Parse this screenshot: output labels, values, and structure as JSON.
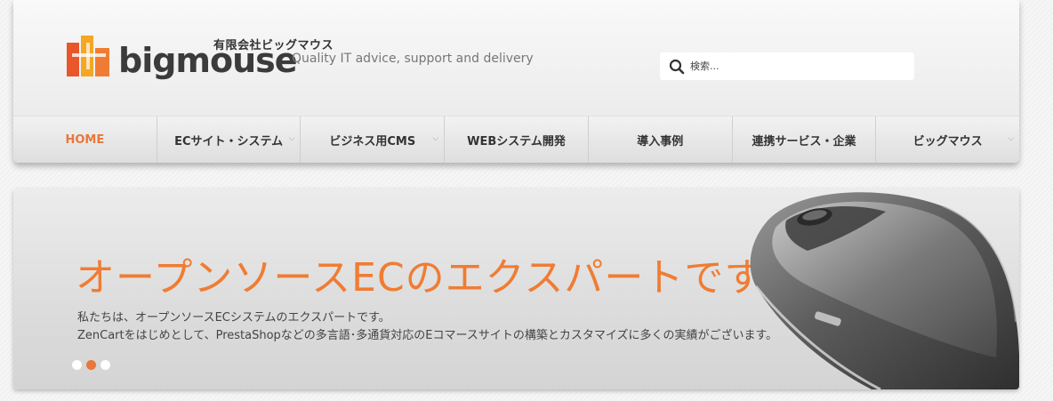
{
  "header": {
    "logo_kana": "有限会社ビッグマウス",
    "logo_name": "bigmouse",
    "tagline": "Quality IT advice, support and delivery",
    "search": {
      "placeholder": "検索..."
    }
  },
  "nav": {
    "items": [
      {
        "label": "HOME",
        "active": true
      },
      {
        "label": "ECサイト・システム",
        "dropdown": true
      },
      {
        "label": "ビジネス用CMS",
        "dropdown": true
      },
      {
        "label": "WEBシステム開発"
      },
      {
        "label": "導入事例"
      },
      {
        "label": "連携サービス・企業"
      },
      {
        "label": "ビッグマウス",
        "dropdown": true
      }
    ]
  },
  "hero": {
    "title": "オープンソースECのエクスパートです",
    "line1": "私たちは、オープンソースECシステムのエクスパートです。",
    "line2": "ZenCartをはじめとして、PrestaShopなどの多言語･多通貨対応のEコマースサイトの構築とカスタマイズに多くの実績がございます。",
    "slides": 3,
    "active_slide": 1
  },
  "colors": {
    "accent": "#e8773a",
    "logo_orange": "#f07c33"
  },
  "icons": {
    "search": "search-icon",
    "dropdown": "chevron-down-icon",
    "hero_image": "computer-mouse-image"
  }
}
